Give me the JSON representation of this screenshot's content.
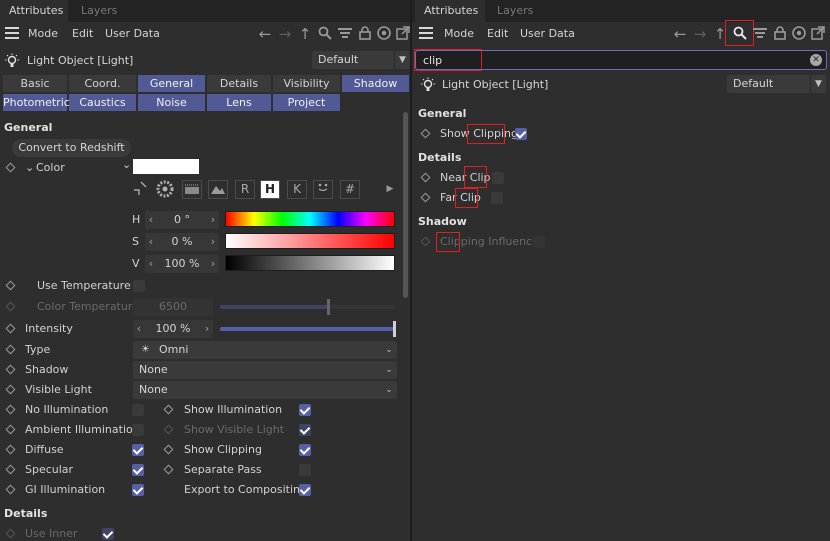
{
  "left": {
    "tabs": [
      "Attributes",
      "Layers"
    ],
    "menu": [
      "Mode",
      "Edit",
      "User Data"
    ],
    "object_title": "Light Object [Light]",
    "preset": "Default",
    "prop_tabs_row1": [
      "Basic",
      "Coord.",
      "General",
      "Details",
      "Visibility",
      "Shadow"
    ],
    "prop_tabs_row2": [
      "Photometric",
      "Caustics",
      "Noise",
      "Lens",
      "Project"
    ],
    "section_general": "General",
    "convert_button": "Convert to Redshift",
    "color_label": "Color",
    "color_modes": [
      "R",
      "H",
      "K",
      "#"
    ],
    "h_label": "H",
    "h_value": "0 °",
    "s_label": "S",
    "s_value": "0 %",
    "v_label": "V",
    "v_value": "100 %",
    "use_temperature": "Use Temperature",
    "color_temperature": "Color Temperature",
    "color_temperature_value": "6500",
    "intensity": "Intensity",
    "intensity_value": "100 %",
    "type": "Type",
    "type_value": "Omni",
    "shadow": "Shadow",
    "shadow_value": "None",
    "visible_light": "Visible Light",
    "visible_light_value": "None",
    "checks_left": [
      {
        "label": "No Illumination",
        "checked": false
      },
      {
        "label": "Ambient Illumination",
        "checked": false
      },
      {
        "label": "Diffuse",
        "checked": true
      },
      {
        "label": "Specular",
        "checked": true
      },
      {
        "label": "GI Illumination",
        "checked": true
      }
    ],
    "checks_right": [
      {
        "label": "Show Illumination",
        "checked": true
      },
      {
        "label": "Show Visible Light",
        "checked": true,
        "disabled": true
      },
      {
        "label": "Show Clipping",
        "checked": true
      },
      {
        "label": "Separate Pass",
        "checked": false
      },
      {
        "label": "Export to Compositing",
        "checked": true
      }
    ],
    "section_details": "Details",
    "use_inner": "Use Inner"
  },
  "right": {
    "tabs": [
      "Attributes",
      "Layers"
    ],
    "menu": [
      "Mode",
      "Edit",
      "User Data"
    ],
    "search_value": "clip",
    "object_title": "Light Object [Light]",
    "preset": "Default",
    "section_general": "General",
    "show_clipping_pre": "Show ",
    "show_clipping_hl": "Clipping",
    "section_details": "Details",
    "near_clip_pre": "Near ",
    "near_clip_hl": "Clip",
    "far_clip_pre": "Far ",
    "far_clip_hl": "Clip",
    "section_shadow": "Shadow",
    "clipping_influence_hl": "Clipping",
    "clipping_influence_post": " Influence"
  },
  "colors": {
    "accent": "#5660a8",
    "highlight": "#e02020"
  }
}
